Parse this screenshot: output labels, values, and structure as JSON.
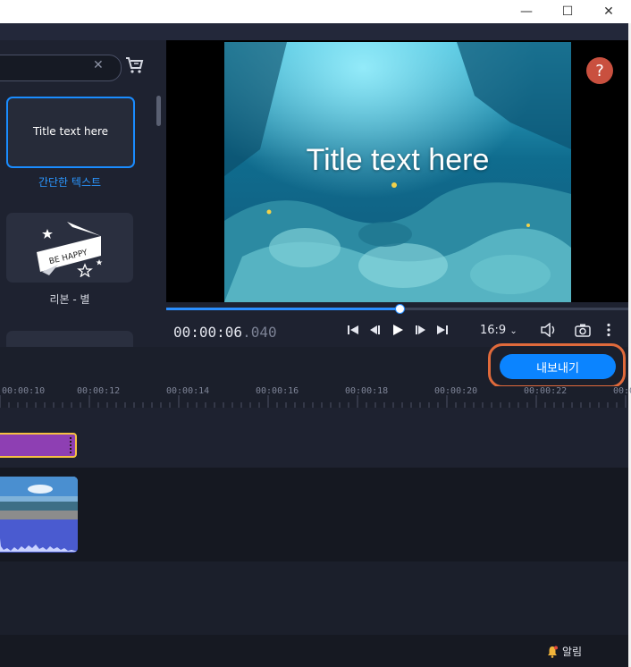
{
  "window": {
    "minimize_glyph": "—",
    "maximize_glyph": "☐",
    "close_glyph": "✕"
  },
  "left_panel": {
    "search": {
      "value": "",
      "placeholder": ""
    },
    "items": [
      {
        "tile_text": "Title text here",
        "label": "간단한 텍스트",
        "selected": true
      },
      {
        "tile_text": "BE HAPPY",
        "label": "리본 - 별",
        "selected": false
      }
    ]
  },
  "player": {
    "overlay_title": "Title text here",
    "help_label": "?",
    "timecode_main": "00:00:06",
    "timecode_ms": ".040",
    "progress": 0.505,
    "aspect_ratio": "16:9"
  },
  "toolbar": {
    "export_label": "내보내기"
  },
  "ruler": {
    "ticks": [
      "00:00:10",
      "00:00:12",
      "00:00:14",
      "00:00:16",
      "00:00:18",
      "00:00:20",
      "00:00:22",
      "00:0"
    ]
  },
  "statusbar": {
    "notifications_label": "알림"
  },
  "colors": {
    "accent": "#0b84ff",
    "export_highlight": "#e06a3b",
    "title_clip": "#8e3fb3",
    "help_button": "#c9503f"
  },
  "icons": [
    "cart-icon",
    "search-clear-icon",
    "skip-start-icon",
    "prev-frame-icon",
    "play-icon",
    "next-frame-icon",
    "skip-end-icon",
    "volume-icon",
    "camera-icon",
    "more-icon",
    "bell-icon"
  ]
}
